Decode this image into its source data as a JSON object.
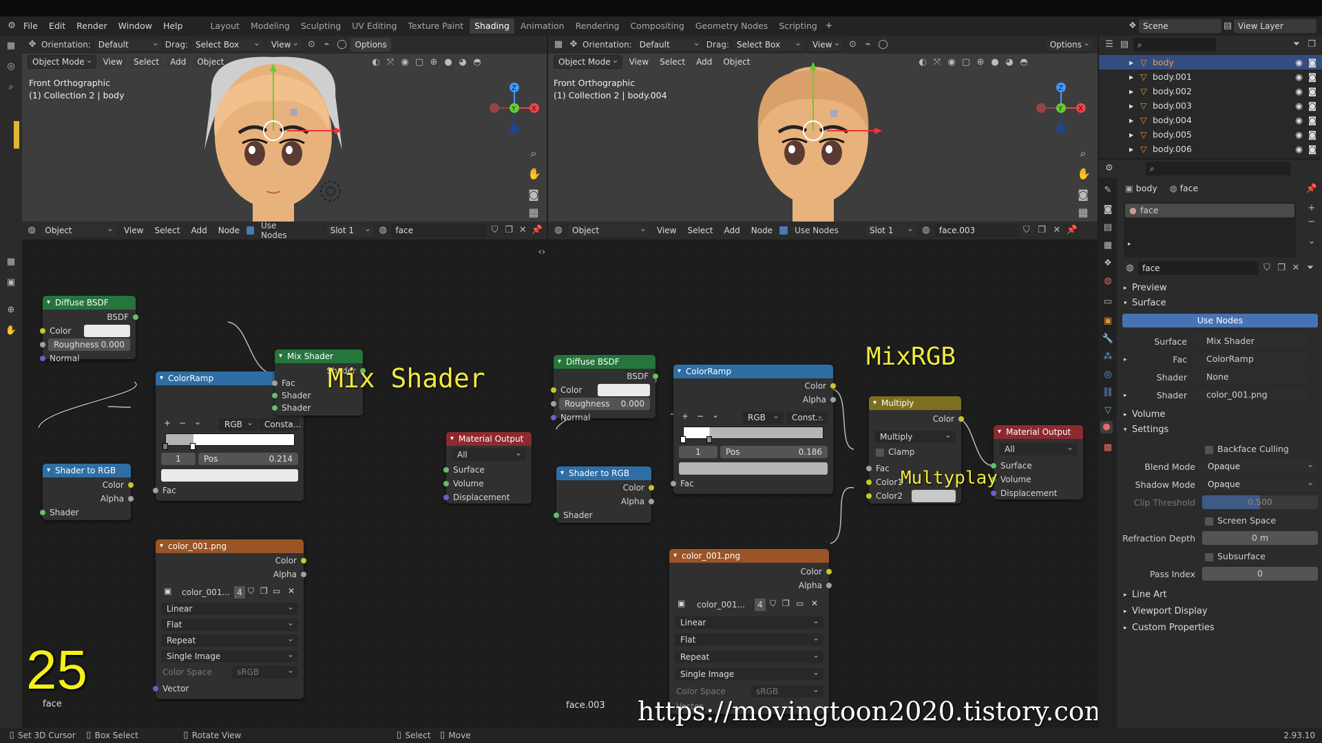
{
  "topmenu": {
    "items": [
      "File",
      "Edit",
      "Render",
      "Window",
      "Help"
    ],
    "workspaces": [
      "Layout",
      "Modeling",
      "Sculpting",
      "UV Editing",
      "Texture Paint",
      "Shading",
      "Animation",
      "Rendering",
      "Compositing",
      "Geometry Nodes",
      "Scripting"
    ],
    "active_workspace": "Shading",
    "scene": "Scene",
    "view_layer": "View Layer"
  },
  "viewport_left": {
    "orientation_label": "Orientation:",
    "orientation": "Default",
    "drag_label": "Drag:",
    "drag": "Select Box",
    "view": "View",
    "options": "Options",
    "mode": "Object Mode",
    "menus": [
      "View",
      "Select",
      "Add",
      "Object"
    ],
    "overlay_line1": "Front Orthographic",
    "overlay_line2": "(1) Collection 2 | body"
  },
  "viewport_right": {
    "orientation_label": "Orientation:",
    "orientation": "Default",
    "drag_label": "Drag:",
    "drag": "Select Box",
    "view": "View",
    "options": "Options",
    "mode": "Object Mode",
    "menus": [
      "View",
      "Select",
      "Add",
      "Object"
    ],
    "overlay_line1": "Front Orthographic",
    "overlay_line2": "(1) Collection 2 | body.004"
  },
  "node_left": {
    "type": "Object",
    "menus": [
      "View",
      "Select",
      "Add",
      "Node"
    ],
    "use_nodes": "Use Nodes",
    "slot": "Slot 1",
    "material": "face",
    "footer_material": "face",
    "step_number": "25",
    "annotation": "Mix Shader",
    "diffuse": {
      "title": "Diffuse BSDF",
      "out": "BSDF",
      "color": "Color",
      "roughness_label": "Roughness",
      "roughness": "0.000",
      "normal": "Normal"
    },
    "shader_to_rgb": {
      "title": "Shader to RGB",
      "color": "Color",
      "alpha": "Alpha",
      "shader": "Shader"
    },
    "colorramp": {
      "title": "ColorRamp",
      "color": "Color",
      "alpha": "Alpha",
      "mode": "RGB",
      "interp": "Consta...",
      "index": "1",
      "pos_label": "Pos",
      "pos": "0.214",
      "fac": "Fac"
    },
    "mix_shader": {
      "title": "Mix Shader",
      "shader_out": "Shader",
      "fac": "Fac",
      "shader1": "Shader",
      "shader2": "Shader"
    },
    "output": {
      "title": "Material Output",
      "target": "All",
      "surface": "Surface",
      "volume": "Volume",
      "displacement": "Displacement"
    },
    "image": {
      "title": "color_001.png",
      "color": "Color",
      "alpha": "Alpha",
      "name": "color_001...",
      "users": "4",
      "interp": "Linear",
      "proj": "Flat",
      "ext": "Repeat",
      "source": "Single Image",
      "cs_label": "Color Space",
      "cs": "sRGB",
      "vector": "Vector"
    }
  },
  "node_right": {
    "type": "Object",
    "menus": [
      "View",
      "Select",
      "Add",
      "Node"
    ],
    "use_nodes": "Use Nodes",
    "slot": "Slot 1",
    "material": "face.003",
    "footer_material": "face.003",
    "annotation_title": "MixRGB",
    "annotation_multiply": "Multyplay",
    "diffuse": {
      "title": "Diffuse BSDF",
      "out": "BSDF",
      "color": "Color",
      "roughness_label": "Roughness",
      "roughness": "0.000",
      "normal": "Normal"
    },
    "shader_to_rgb": {
      "title": "Shader to RGB",
      "color": "Color",
      "alpha": "Alpha",
      "shader": "Shader"
    },
    "colorramp": {
      "title": "ColorRamp",
      "color": "Color",
      "alpha": "Alpha",
      "mode": "RGB",
      "interp": "Const...",
      "index": "1",
      "pos_label": "Pos",
      "pos": "0.186",
      "fac": "Fac"
    },
    "multiply": {
      "title": "Multiply",
      "color": "Color",
      "blend": "Multiply",
      "clamp": "Clamp",
      "fac": "Fac",
      "color1": "Color1",
      "color2": "Color2"
    },
    "output": {
      "title": "Material Output",
      "target": "All",
      "surface": "Surface",
      "volume": "Volume",
      "displacement": "Displacement"
    },
    "image": {
      "title": "color_001.png",
      "color": "Color",
      "alpha": "Alpha",
      "name": "color_001...",
      "users": "4",
      "interp": "Linear",
      "proj": "Flat",
      "ext": "Repeat",
      "source": "Single Image",
      "cs_label": "Color Space",
      "cs": "sRGB",
      "vector": "Vector"
    }
  },
  "outliner": {
    "items": [
      "body",
      "body.001",
      "body.002",
      "body.003",
      "body.004",
      "body.005",
      "body.006"
    ]
  },
  "properties": {
    "object": "body",
    "material_crumb": "face",
    "slot_name": "face",
    "material_name": "face",
    "sections": {
      "preview": "Preview",
      "surface": "Surface",
      "volume": "Volume",
      "settings": "Settings",
      "line_art": "Line Art",
      "viewport_display": "Viewport Display",
      "custom_properties": "Custom Properties"
    },
    "use_nodes": "Use Nodes",
    "surface_label": "Surface",
    "surface_value": "Mix Shader",
    "fac_label": "Fac",
    "fac_value": "ColorRamp",
    "shader1_label": "Shader",
    "shader1_value": "None",
    "shader2_label": "Shader",
    "shader2_value": "color_001.png",
    "backface": "Backface Culling",
    "blend_label": "Blend Mode",
    "blend_value": "Opaque",
    "shadow_label": "Shadow Mode",
    "shadow_value": "Opaque",
    "clip_label": "Clip Threshold",
    "clip_value": "0.500",
    "ssr": "Screen Space Refraction",
    "refr_label": "Refraction Depth",
    "refr_value": "0 m",
    "sss": "Subsurface Translucency",
    "pass_label": "Pass Index",
    "pass_value": "0"
  },
  "statusbar": {
    "items": [
      "Set 3D Cursor",
      "Box Select",
      "Rotate View",
      "Select",
      "Move"
    ],
    "version": "2.93.10"
  },
  "watermark": "https://movingtoon2020.tistory.com"
}
